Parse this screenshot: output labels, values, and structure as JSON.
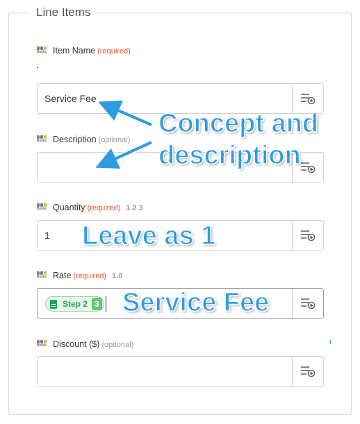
{
  "section": {
    "title": "Line Items"
  },
  "app_icon": {
    "name": "freshbooks-app-icon",
    "text": "Books"
  },
  "fields": [
    {
      "label": "Item Name",
      "tag": "(required)",
      "hint": "",
      "value": "Service Fee"
    },
    {
      "label": "Description",
      "tag": "(optional)",
      "hint": "",
      "value": ""
    },
    {
      "label": "Quantity",
      "tag": "(required)",
      "hint": "1 2 3",
      "value": "1"
    },
    {
      "label": "Rate",
      "tag": "(required)",
      "hint": "1.0",
      "value": "",
      "token": {
        "step": "Step 2",
        "number": "3"
      }
    },
    {
      "label": "Discount ($)",
      "tag": "(optional)",
      "hint": "",
      "value": ""
    }
  ],
  "annotations": {
    "concept": "Concept and",
    "description": "description",
    "leave": "Leave as 1",
    "service": "Service Fee"
  },
  "colors": {
    "required": "#e2562c",
    "annotation": "#2e9be3",
    "token_bg": "#e9f8ec",
    "token_border": "#8ad59a",
    "token_number": "#5ec96e"
  },
  "icons": {
    "field_button": "list-add-icon",
    "token": "google-sheets-icon"
  }
}
